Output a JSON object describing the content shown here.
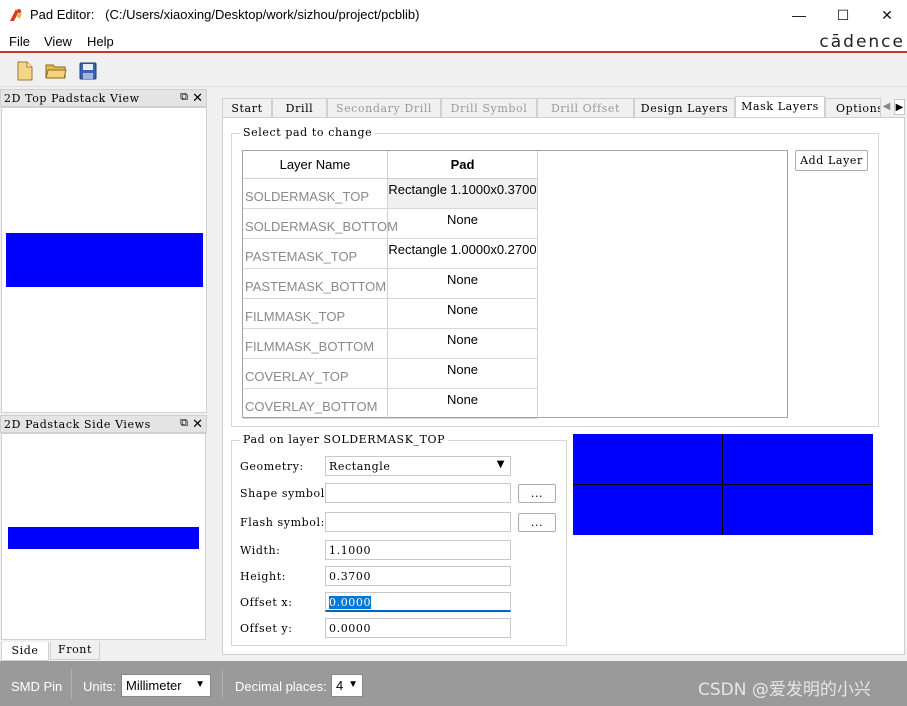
{
  "window": {
    "title": "Pad Editor:",
    "path": "(C:/Users/xiaoxing/Desktop/work/sizhou/project/pcblib)",
    "controls": {
      "minimize": "—",
      "maximize": "☐",
      "close": "✕"
    }
  },
  "menu": {
    "file": "File",
    "view": "View",
    "help": "Help",
    "logo": "cādence"
  },
  "toolbar": {
    "icons": [
      "new-file-icon",
      "open-folder-icon",
      "save-icon"
    ]
  },
  "top_dock": {
    "title": "2D Top Padstack View",
    "float": "⧉",
    "close": "✕",
    "pad_color": "#0000ff"
  },
  "side_dock": {
    "title": "2D Padstack Side Views",
    "float": "⧉",
    "close": "✕",
    "tabs": {
      "side": "Side",
      "front": "Front"
    }
  },
  "tabs": {
    "start": "Start",
    "drill": "Drill",
    "secondary_drill": "Secondary Drill",
    "drill_symbol": "Drill Symbol",
    "drill_offset": "Drill Offset",
    "design_layers": "Design Layers",
    "mask_layers": "Mask Layers",
    "options": "Options",
    "arrow_left": "◀",
    "arrow_right": "▶"
  },
  "select_pad": {
    "title": "Select pad to change",
    "col_layer": "Layer Name",
    "col_pad": "Pad",
    "add_layer": "Add Layer",
    "rows": [
      {
        "layer": "SOLDERMASK_TOP",
        "pad": "Rectangle 1.1000x0.3700"
      },
      {
        "layer": "SOLDERMASK_BOTTOM",
        "pad": "None"
      },
      {
        "layer": "PASTEMASK_TOP",
        "pad": "Rectangle 1.0000x0.2700"
      },
      {
        "layer": "PASTEMASK_BOTTOM",
        "pad": "None"
      },
      {
        "layer": "FILMMASK_TOP",
        "pad": "None"
      },
      {
        "layer": "FILMMASK_BOTTOM",
        "pad": "None"
      },
      {
        "layer": "COVERLAY_TOP",
        "pad": "None"
      },
      {
        "layer": "COVERLAY_BOTTOM",
        "pad": "None"
      }
    ]
  },
  "pad_on_layer": {
    "title": "Pad on layer SOLDERMASK_TOP",
    "geometry_label": "Geometry:",
    "geometry_value": "Rectangle",
    "shape_symbol_label": "Shape symbol:",
    "shape_symbol_value": "",
    "flash_symbol_label": "Flash symbol:",
    "flash_symbol_value": "",
    "browse": "...",
    "width_label": "Width:",
    "width_value": "1.1000",
    "height_label": "Height:",
    "height_value": "0.3700",
    "offset_x_label": "Offset x:",
    "offset_x_value": "0.0000",
    "offset_y_label": "Offset y:",
    "offset_y_value": "0.0000"
  },
  "status": {
    "pin_type": "SMD Pin",
    "units_label": "Units:",
    "units_value": "Millimeter",
    "decimal_label": "Decimal places:",
    "decimal_value": "4",
    "watermark": "CSDN @爱发明的小兴"
  },
  "colors": {
    "pad_blue": "#0000ff",
    "menu_accent": "#c0392b",
    "statusbar": "#9a9a9a"
  }
}
